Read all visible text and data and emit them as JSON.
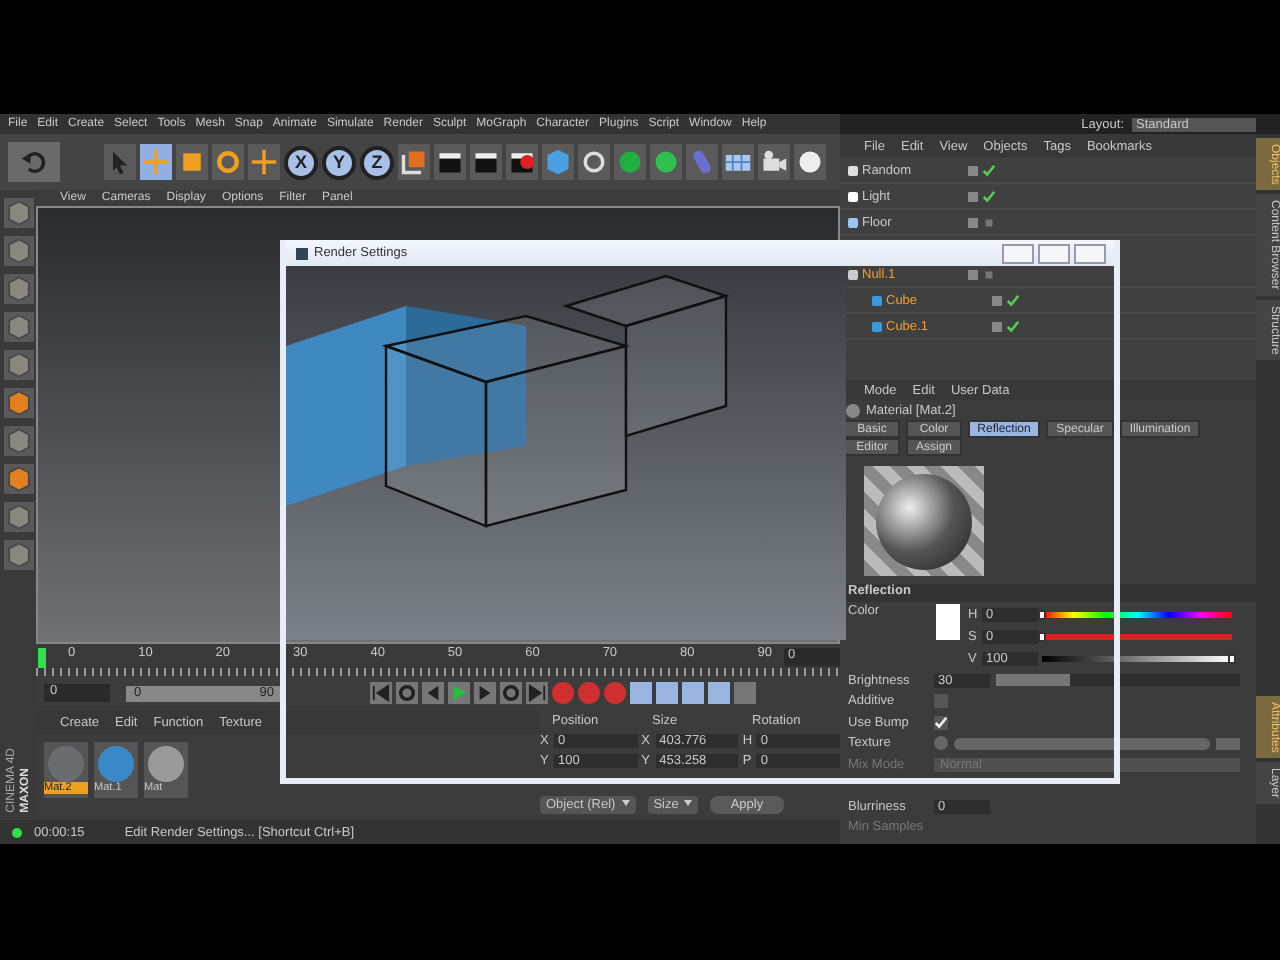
{
  "menu_bar": [
    "File",
    "Edit",
    "Create",
    "Select",
    "Tools",
    "Mesh",
    "Snap",
    "Animate",
    "Simulate",
    "Render",
    "Sculpt",
    "MoGraph",
    "Character",
    "Plugins",
    "Script",
    "Window",
    "Help"
  ],
  "axis_buttons": [
    {
      "label": "X",
      "selected": true
    },
    {
      "label": "Y",
      "selected": true
    },
    {
      "label": "Z",
      "selected": true
    }
  ],
  "viewport": {
    "menu": [
      "View",
      "Cameras",
      "Display",
      "Options",
      "Filter",
      "Panel"
    ]
  },
  "render_window": {
    "title": "Render Settings"
  },
  "timeline": {
    "ticks": [
      "0",
      "10",
      "20",
      "30",
      "40",
      "50",
      "60",
      "70",
      "80",
      "90"
    ],
    "end_field": "0"
  },
  "transport": {
    "start_field": "0",
    "range_start": "0",
    "range_end": "90"
  },
  "materials": {
    "menu": [
      "Create",
      "Edit",
      "Function",
      "Texture"
    ],
    "items": [
      {
        "label": "Mat.2",
        "selected": true,
        "color": "#6a6c70"
      },
      {
        "label": "Mat.1",
        "selected": false,
        "color": "#3a88c8"
      },
      {
        "label": "Mat",
        "selected": false,
        "color": "#9a9a9a"
      }
    ]
  },
  "coordinates": {
    "headers": [
      "Position",
      "Size",
      "Rotation"
    ],
    "rows": [
      [
        {
          "axis": "X",
          "value": "0"
        },
        {
          "axis": "X",
          "value": "403.776"
        },
        {
          "axis": "H",
          "value": "0"
        }
      ],
      [
        {
          "axis": "Y",
          "value": "100"
        },
        {
          "axis": "Y",
          "value": "453.258"
        },
        {
          "axis": "P",
          "value": "0"
        }
      ]
    ],
    "mode": "Object (Rel)",
    "size_mode": "Size",
    "apply": "Apply"
  },
  "brand": [
    "MAXON",
    "CINEMA 4D"
  ],
  "status_bar": {
    "time": "00:00:15",
    "message": "Edit Render Settings... [Shortcut Ctrl+B]"
  },
  "layout": {
    "label": "Layout:",
    "value": "Standard"
  },
  "object_manager": {
    "menu": [
      "File",
      "Edit",
      "View",
      "Objects",
      "Tags",
      "Bookmarks"
    ],
    "objects": [
      {
        "name": "Random",
        "kind": "effector",
        "selected": false,
        "checked": true
      },
      {
        "name": "Light",
        "kind": "light",
        "selected": false,
        "checked": true
      },
      {
        "name": "Floor",
        "kind": "floor",
        "selected": false,
        "checked": false
      },
      {
        "name": "Null.1",
        "kind": "null",
        "selected": true,
        "checked": false,
        "children": [
          {
            "name": "Cube",
            "kind": "cube",
            "selected": true,
            "checked": true
          },
          {
            "name": "Cube.1",
            "kind": "cube",
            "selected": true,
            "checked": true
          }
        ]
      }
    ]
  },
  "side_tabs_top": [
    {
      "label": "Objects",
      "selected": true
    },
    {
      "label": "Content Browser",
      "selected": false
    },
    {
      "label": "Structure",
      "selected": false
    }
  ],
  "side_tabs_bottom": [
    {
      "label": "Attributes",
      "selected": true
    },
    {
      "label": "Layer",
      "selected": false
    }
  ],
  "attributes": {
    "menu": [
      "Mode",
      "Edit",
      "User Data"
    ],
    "title": "Material [Mat.2]",
    "tabs": [
      {
        "label": "Basic",
        "selected": false
      },
      {
        "label": "Color",
        "selected": false
      },
      {
        "label": "Reflection",
        "selected": true
      },
      {
        "label": "Specular",
        "selected": false
      },
      {
        "label": "Illumination",
        "selected": false
      },
      {
        "label": "Editor",
        "selected": false
      },
      {
        "label": "Assign",
        "selected": false
      }
    ],
    "section": "Reflection",
    "color": {
      "label": "Color",
      "channels": [
        {
          "kind": "hue",
          "label": "H",
          "value": "0",
          "level": 0
        },
        {
          "kind": "saturation",
          "label": "S",
          "value": "0",
          "level": 0
        },
        {
          "kind": "value",
          "label": "V",
          "value": "100",
          "level": 1
        }
      ]
    },
    "rows": [
      {
        "kind": "number",
        "label": "Brightness",
        "value": "30",
        "level": 0.3,
        "disabled": false
      },
      {
        "kind": "checkbox",
        "label": "Additive",
        "checked": false,
        "disabled": false
      },
      {
        "kind": "checkbox",
        "label": "Use Bump",
        "checked": true,
        "disabled": false
      },
      {
        "kind": "texture",
        "label": "Texture",
        "disabled": false
      },
      {
        "kind": "dropdown",
        "label": "Mix Mode",
        "value": "Normal",
        "disabled": true
      },
      {
        "kind": "number",
        "label": "Blurriness",
        "value": "0",
        "disabled": false
      },
      {
        "kind": "label",
        "label": "Min Samples",
        "disabled": true
      }
    ]
  }
}
